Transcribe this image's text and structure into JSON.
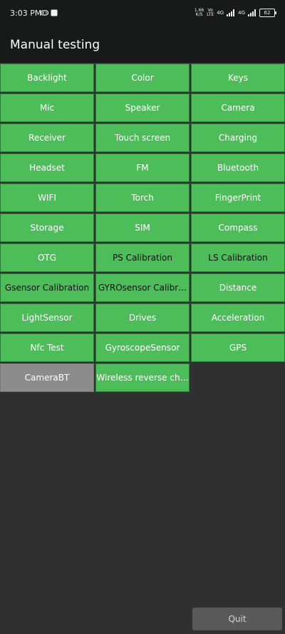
{
  "status": {
    "time": "3:03 PM",
    "speed": "1.66",
    "speed_unit": "K/S",
    "net1": "Vo",
    "net1_sub": "LTE",
    "net1_label": "4G",
    "net2_label": "4G",
    "battery": "62"
  },
  "page": {
    "title": "Manual testing"
  },
  "buttons": [
    {
      "label": "Backlight",
      "style": "green"
    },
    {
      "label": "Color",
      "style": "green"
    },
    {
      "label": "Keys",
      "style": "green"
    },
    {
      "label": "Mic",
      "style": "green"
    },
    {
      "label": "Speaker",
      "style": "green"
    },
    {
      "label": "Camera",
      "style": "green"
    },
    {
      "label": "Receiver",
      "style": "green"
    },
    {
      "label": "Touch screen",
      "style": "green"
    },
    {
      "label": "Charging",
      "style": "green"
    },
    {
      "label": "Headset",
      "style": "green"
    },
    {
      "label": "FM",
      "style": "green"
    },
    {
      "label": "Bluetooth",
      "style": "green"
    },
    {
      "label": "WIFI",
      "style": "green"
    },
    {
      "label": "Torch",
      "style": "green"
    },
    {
      "label": "FingerPrint",
      "style": "green"
    },
    {
      "label": "Storage",
      "style": "green"
    },
    {
      "label": "SIM",
      "style": "green"
    },
    {
      "label": "Compass",
      "style": "green"
    },
    {
      "label": "OTG",
      "style": "green"
    },
    {
      "label": "PS Calibration",
      "style": "dark"
    },
    {
      "label": "LS Calibration",
      "style": "dark"
    },
    {
      "label": "Gsensor Calibration",
      "style": "dark"
    },
    {
      "label": "GYROsensor Calibr…",
      "style": "dark"
    },
    {
      "label": "Distance",
      "style": "green"
    },
    {
      "label": "LightSensor",
      "style": "green"
    },
    {
      "label": "Drives",
      "style": "green"
    },
    {
      "label": "Acceleration",
      "style": "green"
    },
    {
      "label": "Nfc Test",
      "style": "green"
    },
    {
      "label": "GyroscopeSensor",
      "style": "green"
    },
    {
      "label": "GPS",
      "style": "green"
    },
    {
      "label": "CameraBT",
      "style": "gray"
    },
    {
      "label": "Wireless reverse ch…",
      "style": "green"
    }
  ],
  "footer": {
    "quit_label": "Quit"
  }
}
